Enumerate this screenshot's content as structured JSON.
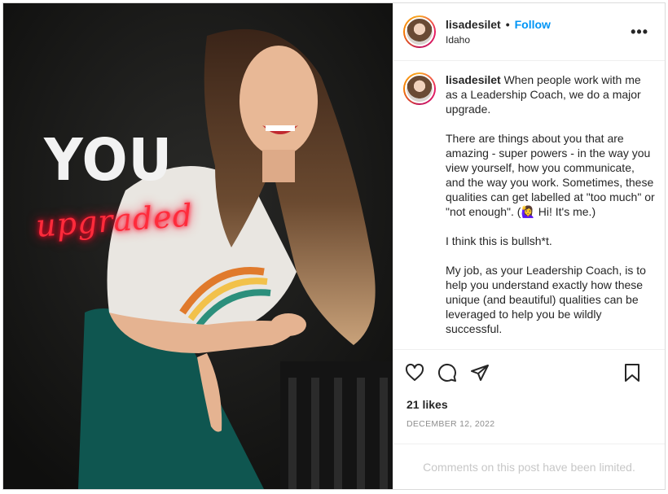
{
  "post": {
    "username": "lisadesilet",
    "separator": "•",
    "follow_label": "Follow",
    "location": "Idaho",
    "more_label": "•••",
    "image_text": {
      "headline": "YOU",
      "neon": "upgraded"
    },
    "caption": {
      "username": "lisadesilet",
      "p1": "When people work with me as a Leadership Coach, we do a major upgrade.",
      "p2": "There are things about you that are amazing - super powers - in the way you view yourself, how you communicate, and the way you work. Sometimes, these qualities can get labelled at \"too much\" or \"not enough\". (🙋‍♀️ Hi! It's me.)",
      "p3": "I think this is bullsh*t.",
      "p4": "My job, as your Leadership Coach, is to help you understand exactly how these unique (and beautiful) qualities can be leveraged to help you be wildly successful."
    },
    "likes": "21 likes",
    "date": "DECEMBER 12, 2022",
    "comments_notice": "Comments on this post have been limited."
  },
  "icons": [
    "heart-icon",
    "comment-icon",
    "share-icon",
    "bookmark-icon",
    "more-options-icon"
  ]
}
